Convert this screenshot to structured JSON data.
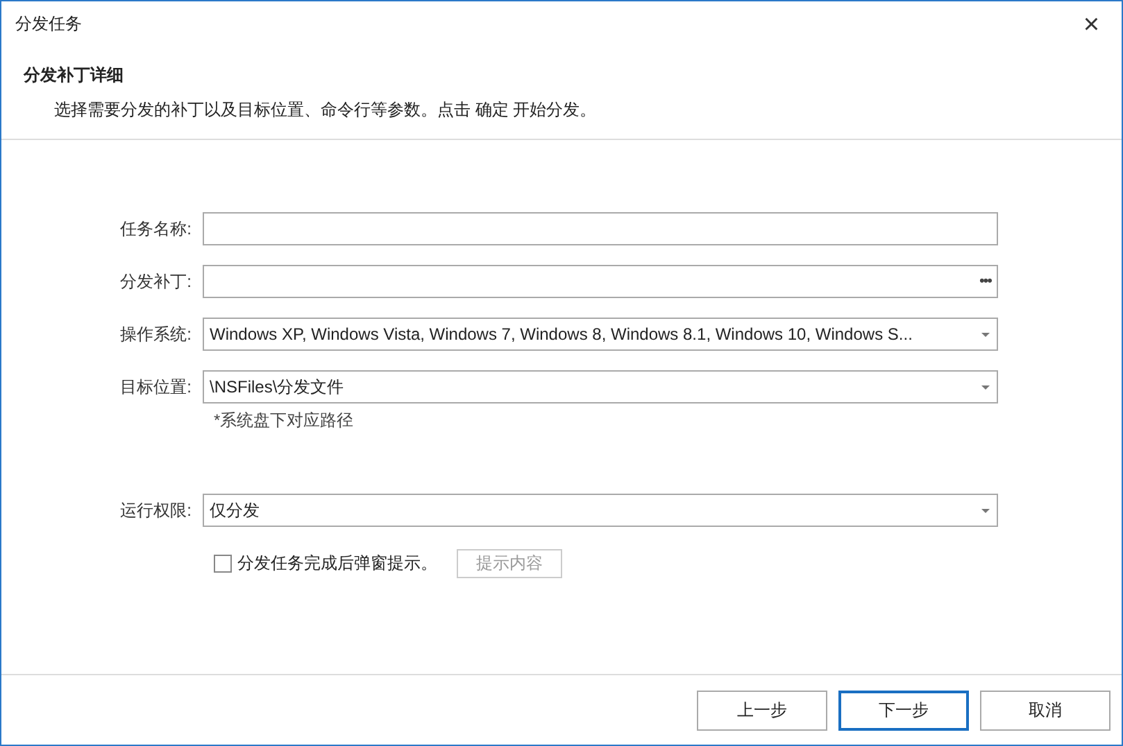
{
  "window": {
    "title": "分发任务",
    "close": "×"
  },
  "header": {
    "title": "分发补丁详细",
    "description": "选择需要分发的补丁以及目标位置、命令行等参数。点击 确定 开始分发。"
  },
  "fields": [
    {
      "kind": "text",
      "label": "任务名称:"
    },
    {
      "kind": "browse",
      "label": "分发补丁:",
      "browse": "•••"
    },
    {
      "kind": "dropdown",
      "label": "操作系统:",
      "value": "Windows XP, Windows Vista, Windows 7, Windows 8, Windows 8.1, Windows 10, Windows S..."
    },
    {
      "kind": "dropdown",
      "label": "目标位置:",
      "value": "\\NSFiles\\分发文件",
      "hint": "*系统盘下对应路径"
    },
    {
      "kind": "dropdown",
      "label": "运行权限:",
      "value": "仅分发"
    }
  ],
  "notify": {
    "label": "分发任务完成后弹窗提示。",
    "checked": false,
    "button": "提示内容",
    "button_disabled": true
  },
  "buttons": [
    {
      "label": "上一步",
      "default": false
    },
    {
      "label": "下一步",
      "default": true
    },
    {
      "label": "取消",
      "default": false
    }
  ]
}
